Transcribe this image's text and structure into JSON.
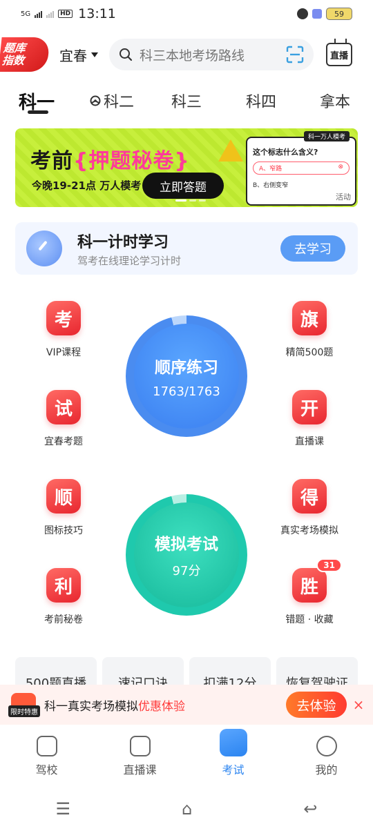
{
  "status": {
    "network": "5G",
    "time": "13:11",
    "battery": "59"
  },
  "header": {
    "logo_line1": "题库",
    "logo_line2": "指数",
    "city": "宜春",
    "search_placeholder": "科三本地考场路线",
    "live_label": "直播"
  },
  "tabs": [
    "科一",
    "科二",
    "科三",
    "科四",
    "拿本"
  ],
  "banner": {
    "title_a": "考前",
    "title_b": "{押题秘卷}",
    "subtitle": "今晚19-21点  万人模考",
    "cta": "立即答题",
    "card_head": "科一万人模考",
    "card_question": "这个标志什么含义?",
    "card_option_a": "A、窄路",
    "card_option_b": "B、右侧变窄",
    "ad_tag": "活动"
  },
  "study": {
    "title": "科一计时学习",
    "subtitle": "驾考在线理论学习计时",
    "button": "去学习"
  },
  "grid": [
    {
      "char": "考",
      "label": "VIP课程"
    },
    {
      "char": "旗",
      "label": "精简500题"
    },
    {
      "char": "试",
      "label": "宜春考题"
    },
    {
      "char": "开",
      "label": "直播课"
    },
    {
      "char": "顺",
      "label": "图标技巧"
    },
    {
      "char": "得",
      "label": "真实考场模拟"
    },
    {
      "char": "利",
      "label": "考前秘卷"
    },
    {
      "char": "胜",
      "label": "错题 · 收藏",
      "badge": "31"
    }
  ],
  "practice": {
    "title": "顺序练习",
    "progress": "1763/1763"
  },
  "exam": {
    "title": "模拟考试",
    "score": "97分"
  },
  "chips": [
    "500题直播",
    "速记口诀",
    "扣满12分",
    "恢复驾驶证"
  ],
  "promo": {
    "tag": "限时特惠",
    "text": "科一真实考场模拟",
    "highlight": "优惠体验",
    "button": "去体验",
    "close": "×"
  },
  "tabbar": [
    {
      "label": "驾校"
    },
    {
      "label": "直播课"
    },
    {
      "label": "考试"
    },
    {
      "label": "我的"
    }
  ],
  "system_nav": [
    "☰",
    "⌂",
    "↩"
  ]
}
